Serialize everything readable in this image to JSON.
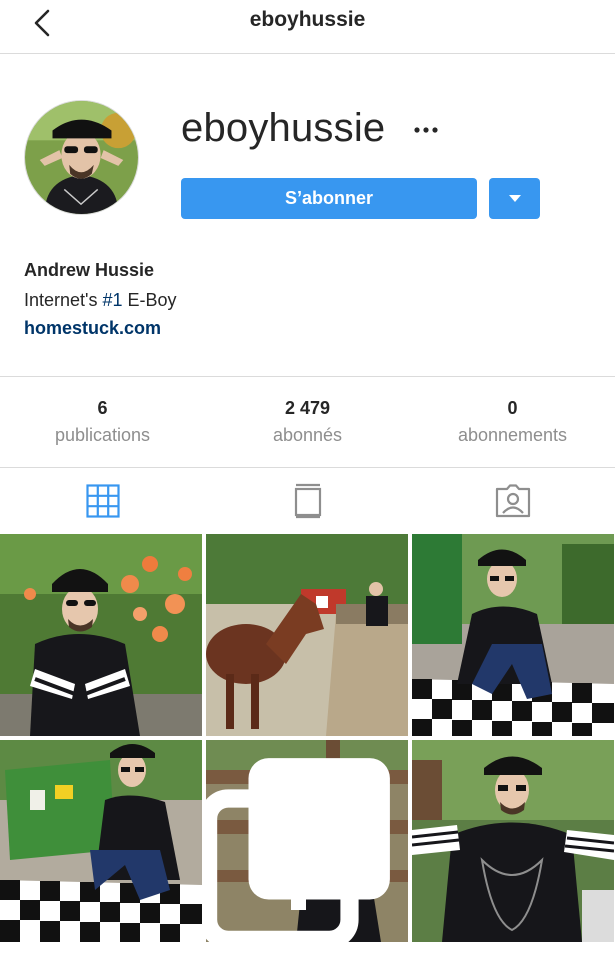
{
  "header": {
    "title": "eboyhussie",
    "back_icon": "chevron-left-icon"
  },
  "profile": {
    "username": "eboyhussie",
    "more_icon": "more-horizontal-icon",
    "follow_label": "S’abonner",
    "dropdown_icon": "triangle-down-icon",
    "accent_color": "#3897f0"
  },
  "bio": {
    "name": "Andrew Hussie",
    "text_before": "Internet's ",
    "hashtag": "#1",
    "text_after": " E-Boy",
    "link": "homestuck.com"
  },
  "stats": [
    {
      "value": "6",
      "label": "publications"
    },
    {
      "value": "2 479",
      "label": "abonnés"
    },
    {
      "value": "0",
      "label": "abonnements"
    }
  ],
  "tabs": [
    {
      "name": "grid-view",
      "icon": "grid-icon",
      "active": true
    },
    {
      "name": "igtv",
      "icon": "igtv-icon",
      "active": false
    },
    {
      "name": "tagged",
      "icon": "tagged-person-icon",
      "active": false
    }
  ],
  "posts": [
    {
      "id": "post-1",
      "description": "man in bucket hat in front of orange roses",
      "multi": false
    },
    {
      "id": "post-2",
      "description": "brown horse by a fence",
      "multi": false
    },
    {
      "id": "post-3",
      "description": "man crouching on checkered mat by dumpster",
      "multi": false
    },
    {
      "id": "post-4",
      "description": "man crouching on checkered mat by green dumpster",
      "multi": false
    },
    {
      "id": "post-5",
      "description": "man crouching by wooden fence",
      "multi": true
    },
    {
      "id": "post-6",
      "description": "man in black shirt pointing",
      "multi": false
    }
  ]
}
